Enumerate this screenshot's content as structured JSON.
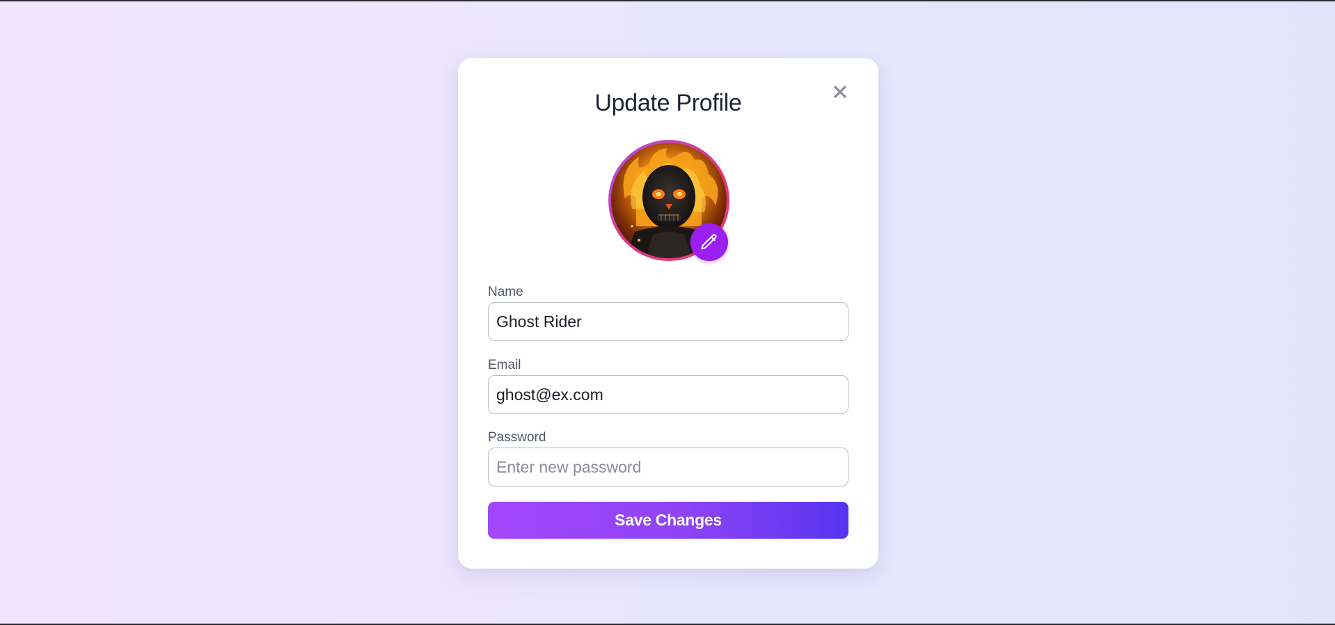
{
  "dialog": {
    "title": "Update Profile",
    "close_icon": "close-icon",
    "avatar": {
      "description_icon": "avatar-image",
      "edit_icon": "pencil-icon",
      "accent_color": "#9b1ff0"
    }
  },
  "form": {
    "name": {
      "label": "Name",
      "value": "Ghost Rider"
    },
    "email": {
      "label": "Email",
      "value": "ghost@ex.com"
    },
    "password": {
      "label": "Password",
      "value": "",
      "placeholder": "Enter new password"
    },
    "save_label": "Save Changes"
  },
  "colors": {
    "button_gradient_start": "#a347fa",
    "button_gradient_end": "#5634ef",
    "title_color": "#1f2433"
  }
}
